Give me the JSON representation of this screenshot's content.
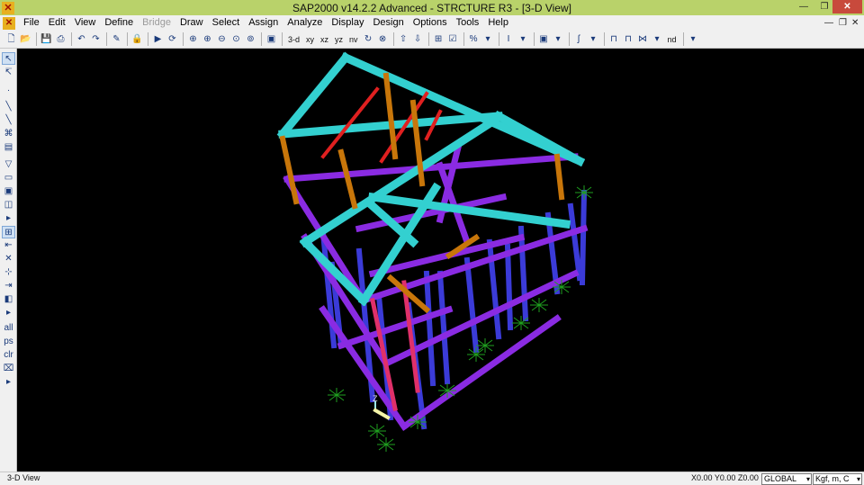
{
  "window": {
    "title": "SAP2000 v14.2.2 Advanced  - STRCTURE R3 - [3-D View]",
    "app_icon": "sap-logo-icon",
    "controls": {
      "minimize": "—",
      "maximize": "❐",
      "close": "✕"
    },
    "mdi_controls": {
      "minimize": "—",
      "restore": "❐",
      "close": "✕"
    }
  },
  "menu": {
    "items": [
      {
        "label": "File",
        "enabled": true
      },
      {
        "label": "Edit",
        "enabled": true
      },
      {
        "label": "View",
        "enabled": true
      },
      {
        "label": "Define",
        "enabled": true
      },
      {
        "label": "Bridge",
        "enabled": false
      },
      {
        "label": "Draw",
        "enabled": true
      },
      {
        "label": "Select",
        "enabled": true
      },
      {
        "label": "Assign",
        "enabled": true
      },
      {
        "label": "Analyze",
        "enabled": true
      },
      {
        "label": "Display",
        "enabled": true
      },
      {
        "label": "Design",
        "enabled": true
      },
      {
        "label": "Options",
        "enabled": true
      },
      {
        "label": "Tools",
        "enabled": true
      },
      {
        "label": "Help",
        "enabled": true
      }
    ]
  },
  "toolbar": {
    "view_buttons": {
      "three_d": "3-d",
      "xy": "xy",
      "xz": "xz",
      "yz": "yz",
      "nv": "nv"
    },
    "nd_label": "nd"
  },
  "viewport": {
    "view_name": "3-D View",
    "axis_label": "Z",
    "colors": {
      "background": "#000000",
      "column": "#3b3bd8",
      "beam_purple": "#8a2be2",
      "beam_cyan": "#33d0d0",
      "beam_orange": "#c8760a",
      "rafter_red": "#e02020",
      "brace_pink": "#e0306a",
      "support": "#1fa01f"
    }
  },
  "status": {
    "view_name": "3-D View",
    "coords": "X0.00  Y0.00  Z0.00",
    "coordinate_system": "GLOBAL",
    "units": "Kgf, m, C"
  }
}
